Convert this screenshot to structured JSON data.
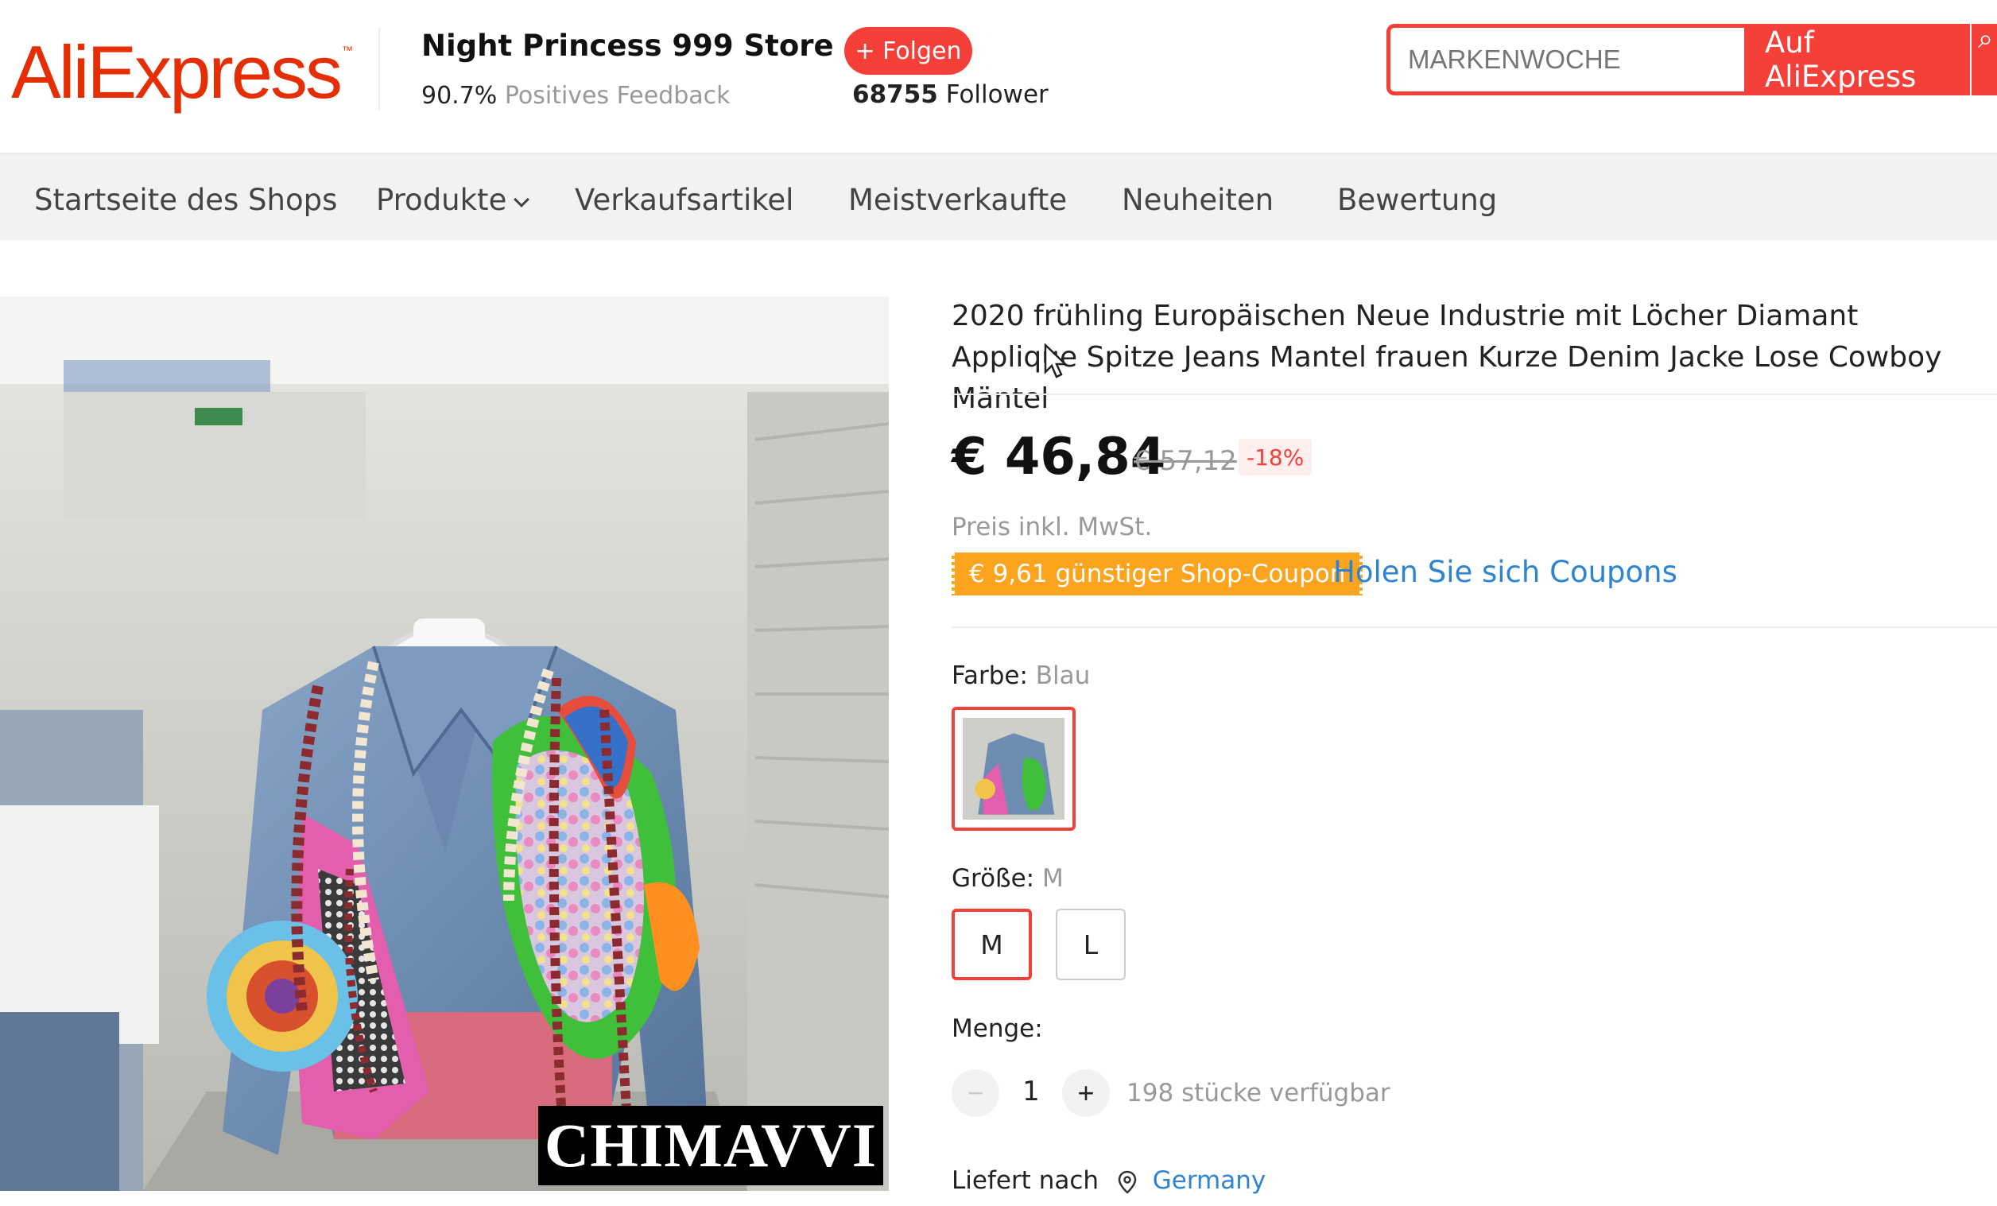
{
  "header": {
    "logo_text": "AliExpress",
    "logo_tm": "™",
    "store_name": "Night Princess 999 Store",
    "feedback_percent": "90.7%",
    "feedback_label": "Positives Feedback",
    "follow_label": "+ Folgen",
    "follower_count": "68755",
    "follower_label": "Follower",
    "search_placeholder": "MARKENWOCHE",
    "search_button": "Auf AliExpress"
  },
  "nav": {
    "items": [
      "Startseite des Shops",
      "Produkte",
      "Verkaufsartikel",
      "Meistverkaufte",
      "Neuheiten",
      "Bewertung"
    ]
  },
  "product": {
    "title": "2020 frühling Europäischen Neue Industrie mit Löcher Diamant Applique Spitze Jeans Mantel frauen Kurze Denim Jacke Lose Cowboy Mäntel",
    "image_watermark": "CHIMAVVI",
    "price": "€ 46,84",
    "original_price": "€ 57,12",
    "discount": "-18%",
    "tax_note": "Preis inkl. MwSt.",
    "coupon_tag": "€ 9,61 günstiger Shop-Coupon",
    "coupon_link": "Holen Sie sich Coupons",
    "color_label": "Farbe:",
    "color_value": "Blau",
    "size_label": "Größe:",
    "size_value": "M",
    "sizes": [
      "M",
      "L"
    ],
    "quantity_label": "Menge:",
    "quantity": "1",
    "minus": "−",
    "plus": "+",
    "availability": "198 stücke verfügbar",
    "ship_label": "Liefert nach",
    "ship_country": "Germany"
  },
  "colors": {
    "brand_red": "#e62e04",
    "accent_red": "#f5403a",
    "coupon_orange": "#fca41e",
    "link_blue": "#2e84d1"
  }
}
